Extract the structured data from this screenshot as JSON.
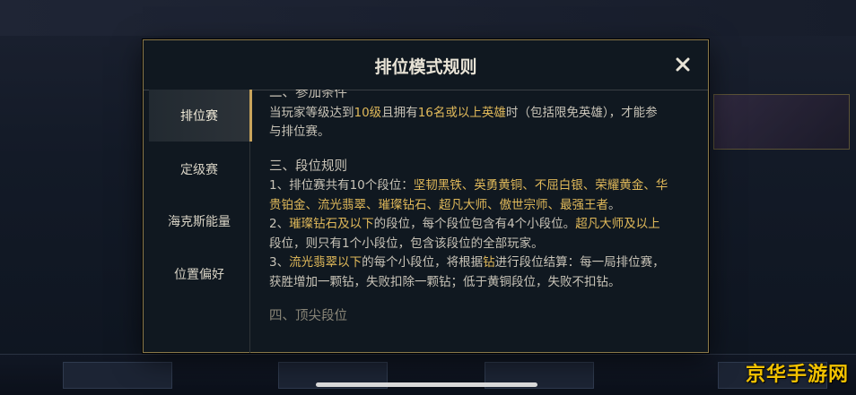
{
  "modal": {
    "title": "排位模式规则",
    "close_icon": "close-icon"
  },
  "tabs": [
    {
      "label": "排位赛",
      "active": true
    },
    {
      "label": "定级赛",
      "active": false
    },
    {
      "label": "海克斯能量",
      "active": false
    },
    {
      "label": "位置偏好",
      "active": false
    }
  ],
  "content": {
    "sec2_title": "二、参加条件",
    "sec2_l1_a": "当玩家等级达到",
    "sec2_l1_b": "10级",
    "sec2_l1_c": "且拥有",
    "sec2_l1_d": "16名或以上英雄",
    "sec2_l1_e": "时（包括限免英雄），才能参",
    "sec2_l2": "与排位赛。",
    "sec3_title": "三、段位规则",
    "r1_a": "1、排位赛共有10个段位：",
    "r1_b": "坚韧黑铁、英勇黄铜、不屈白银、荣耀黄金、华",
    "r1_c": "贵铂金、流光翡翠、璀璨钻石、超凡大师、傲世宗师、最强王者",
    "r1_d": "。",
    "r2_a": "2、",
    "r2_b": "璀璨钻石及以下",
    "r2_c": "的段位，每个段位包含有4个小段位。",
    "r2_d": "超凡大师及以上",
    "r2_e": "段位，则只有1个小段位，包含该段位的全部玩家。",
    "r3_a": "3、",
    "r3_b": "流光翡翠以下",
    "r3_c": "的每个小段位，将根据",
    "r3_d": "钻",
    "r3_e": "进行段位结算：每一局排位赛，",
    "r3_f": "获胜增加一颗钻，失败扣除一颗钻；低于黄铜段位，失败不扣钻。",
    "sec4_title": "四、顶尖段位"
  },
  "watermark": "京华手游网",
  "colors": {
    "accent_gold": "#e0b95a",
    "border_gold": "#8b7a4b",
    "modal_bg": "#101820",
    "watermark": "#f2c200"
  }
}
